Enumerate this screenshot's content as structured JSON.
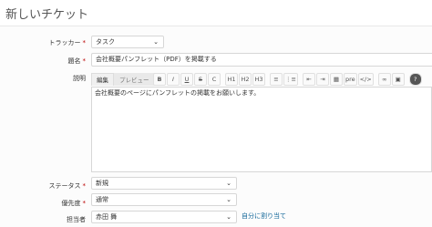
{
  "page": {
    "title": "新しいチケット"
  },
  "fields": {
    "tracker": {
      "label": "トラッカー",
      "required_mark": "*",
      "value": "タスク"
    },
    "subject": {
      "label": "題名",
      "required_mark": "*",
      "value": "会社概要パンフレット（PDF）を掲載する"
    },
    "description": {
      "label": "説明",
      "text": "会社概要のページにパンフレットの掲載をお願いします。"
    },
    "status": {
      "label": "ステータス",
      "required_mark": "*",
      "value": "新規"
    },
    "priority": {
      "label": "優先度",
      "required_mark": "*",
      "value": "通常"
    },
    "assignee": {
      "label": "担当者",
      "value": "赤田 舞",
      "assign_self": "自分に割り当て"
    }
  },
  "editor": {
    "tabs": {
      "edit": "編集",
      "preview": "プレビュー"
    },
    "toolbar": {
      "bold": "B",
      "italic": "I",
      "underline": "U",
      "strike": "S",
      "code": "C",
      "h1": "H1",
      "h2": "H2",
      "h3": "H3",
      "ul": "≡",
      "ol": "⋮≡",
      "outdent": "⇤",
      "indent": "⇥",
      "table": "▦",
      "pre": "pre",
      "html": "</>",
      "link": "∞",
      "image": "▣",
      "help": "?"
    }
  },
  "icons": {
    "dropdown": "chevron-down-icon"
  }
}
